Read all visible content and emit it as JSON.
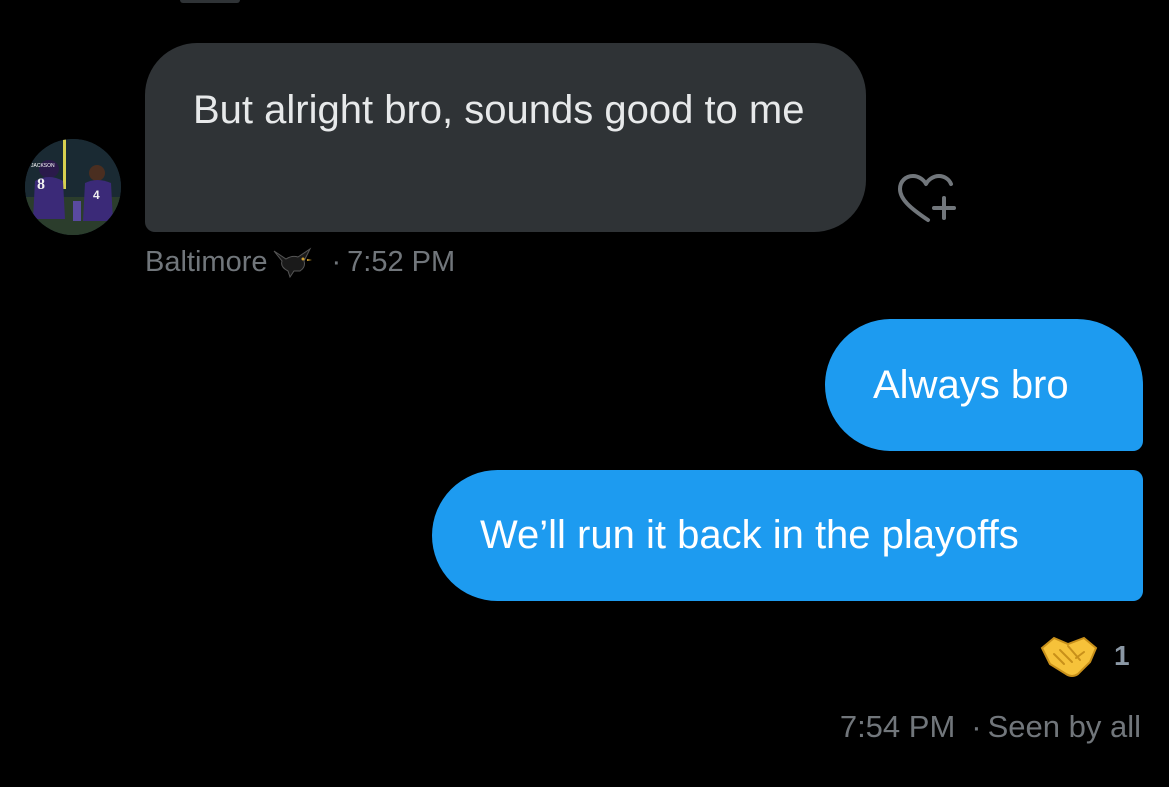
{
  "conversation": {
    "incoming": {
      "avatar": {
        "icon": "profile-avatar"
      },
      "message_text": "But alright bro, sounds good to me",
      "sender_name": "Baltimore",
      "sender_emoji": "blackbird-icon",
      "separator": "·",
      "time": "7:52 PM",
      "add_reaction_icon": "heart-plus-icon"
    },
    "outgoing": [
      {
        "message_text": "Always bro"
      },
      {
        "message_text": "We’ll run it back in the playoffs"
      }
    ],
    "reaction": {
      "emoji": "handshake-icon",
      "count": "1"
    },
    "status": {
      "time": "7:54 PM",
      "separator": "·",
      "seen_text": "Seen by all"
    }
  },
  "colors": {
    "background": "#000000",
    "incoming_bubble": "#2f3336",
    "outgoing_bubble": "#1d9bf0",
    "meta_text": "#71767b"
  }
}
